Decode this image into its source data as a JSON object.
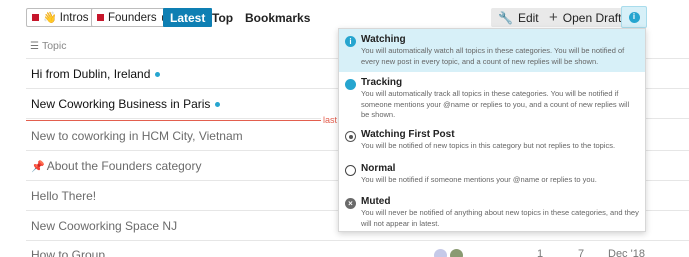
{
  "navbar": {
    "breadcrumbs": [
      {
        "emoji": "👋",
        "label": "Intros",
        "color": "#c6162b"
      },
      {
        "label": "Founders",
        "color": "#c6162b"
      }
    ],
    "tabs": [
      {
        "label": "Latest",
        "active": true
      },
      {
        "label": "Top",
        "active": false
      },
      {
        "label": "Bookmarks",
        "active": false
      }
    ],
    "edit_label": "Edit",
    "new_draft_label": "Open Draft",
    "notification_glyph": "i",
    "accent_color": "#0e7fb3"
  },
  "topic_list": {
    "header": "Topic",
    "last_visit_label": "last v",
    "rows": [
      {
        "title": "Hi from Dublin, Ireland",
        "unread": true,
        "new_indicator": true
      },
      {
        "title": "New Coworking Business in Paris",
        "unread": true,
        "new_indicator": true
      },
      {
        "title": "New to coworking in HCM City, Vietnam",
        "unread": false,
        "new_indicator": false
      },
      {
        "title": "About the Founders category",
        "unread": false,
        "pinned": true
      },
      {
        "title": "Hello There!",
        "unread": false
      },
      {
        "title": "New Cooworking Space NJ",
        "unread": false
      }
    ],
    "partial_row": {
      "title": "How to Group",
      "replies": "1",
      "views": "7",
      "activity": "Dec '18"
    }
  },
  "notification_menu": {
    "options": [
      {
        "id": "watching",
        "title": "Watching",
        "selected": true,
        "glyph": "i",
        "description": "You will automatically watch all topics in these categories. You will be notified of every new post in every topic, and a count of new replies will be shown."
      },
      {
        "id": "tracking",
        "title": "Tracking",
        "selected": false,
        "description": "You will automatically track all topics in these categories. You will be notified if someone mentions your @name or replies to you, and a count of new replies will be shown."
      },
      {
        "id": "watching-first-post",
        "title": "Watching First Post",
        "selected": false,
        "description": "You will be notified of new topics in this category but not replies to the topics."
      },
      {
        "id": "normal",
        "title": "Normal",
        "selected": false,
        "description": "You will be notified if someone mentions your @name or replies to you."
      },
      {
        "id": "muted",
        "title": "Muted",
        "selected": false,
        "glyph": "×",
        "description": "You will never be notified of anything about new topics in these categories, and they will not appear in latest."
      }
    ]
  }
}
